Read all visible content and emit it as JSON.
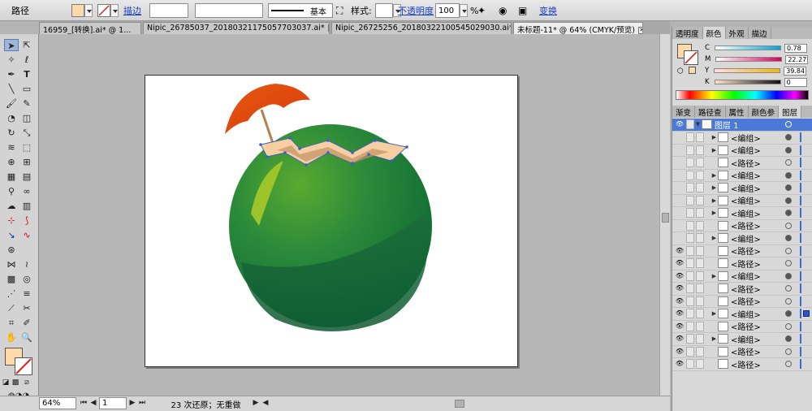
{
  "control_bar": {
    "object_type": "路径",
    "stroke_link": "描边",
    "stroke_weight": "",
    "brush_label": "基本",
    "style_label": "样式:",
    "opacity_link": "不透明度",
    "opacity_value": "100",
    "opacity_unit": "%",
    "transform_link": "变换",
    "fill_color": "#ffd9a8"
  },
  "doc_tabs": [
    {
      "label": "16959_[转换].ai* @ 1..."
    },
    {
      "label": "Nipic_26785037_20180321175057703037.ai*"
    },
    {
      "label": "Nipic_26725256_20180322100545029030.ai*"
    },
    {
      "label": "未标题-11* @ 64% (CMYK/预览)",
      "active": true
    }
  ],
  "color_panel": {
    "tabs": [
      "透明度",
      "颜色",
      "外观",
      "描边"
    ],
    "active_tab": "颜色",
    "channels": [
      {
        "name": "C",
        "value": "0.78"
      },
      {
        "name": "M",
        "value": "22.27"
      },
      {
        "name": "Y",
        "value": "39.84"
      },
      {
        "name": "K",
        "value": "0"
      }
    ]
  },
  "layers_panel": {
    "tabs": [
      "渐变",
      "路径查",
      "属性",
      "颜色参",
      "图层"
    ],
    "active_tab": "图层",
    "layer_name": "图层 1",
    "rows": [
      {
        "label": "<编组>",
        "tri": true
      },
      {
        "label": "<编组>",
        "tri": true
      },
      {
        "label": "<路径>",
        "tri": false
      },
      {
        "label": "<编组>",
        "tri": true
      },
      {
        "label": "<编组>",
        "tri": true
      },
      {
        "label": "<编组>",
        "tri": true
      },
      {
        "label": "<编组>",
        "tri": true
      },
      {
        "label": "<路径>",
        "tri": false
      },
      {
        "label": "<编组>",
        "tri": true
      },
      {
        "label": "<路径>",
        "tri": false
      },
      {
        "label": "<路径>",
        "tri": false
      },
      {
        "label": "<编组>",
        "tri": true
      },
      {
        "label": "<路径>",
        "tri": false
      },
      {
        "label": "<路径>",
        "tri": false
      },
      {
        "label": "<编组>",
        "tri": true
      },
      {
        "label": "<路径>",
        "tri": false
      },
      {
        "label": "<编组>",
        "tri": true
      },
      {
        "label": "<路径>",
        "tri": false
      },
      {
        "label": "<路径>",
        "tri": false
      }
    ]
  },
  "status_bar": {
    "zoom": "64%",
    "page": "1",
    "history": "23 次还原；无重做"
  }
}
